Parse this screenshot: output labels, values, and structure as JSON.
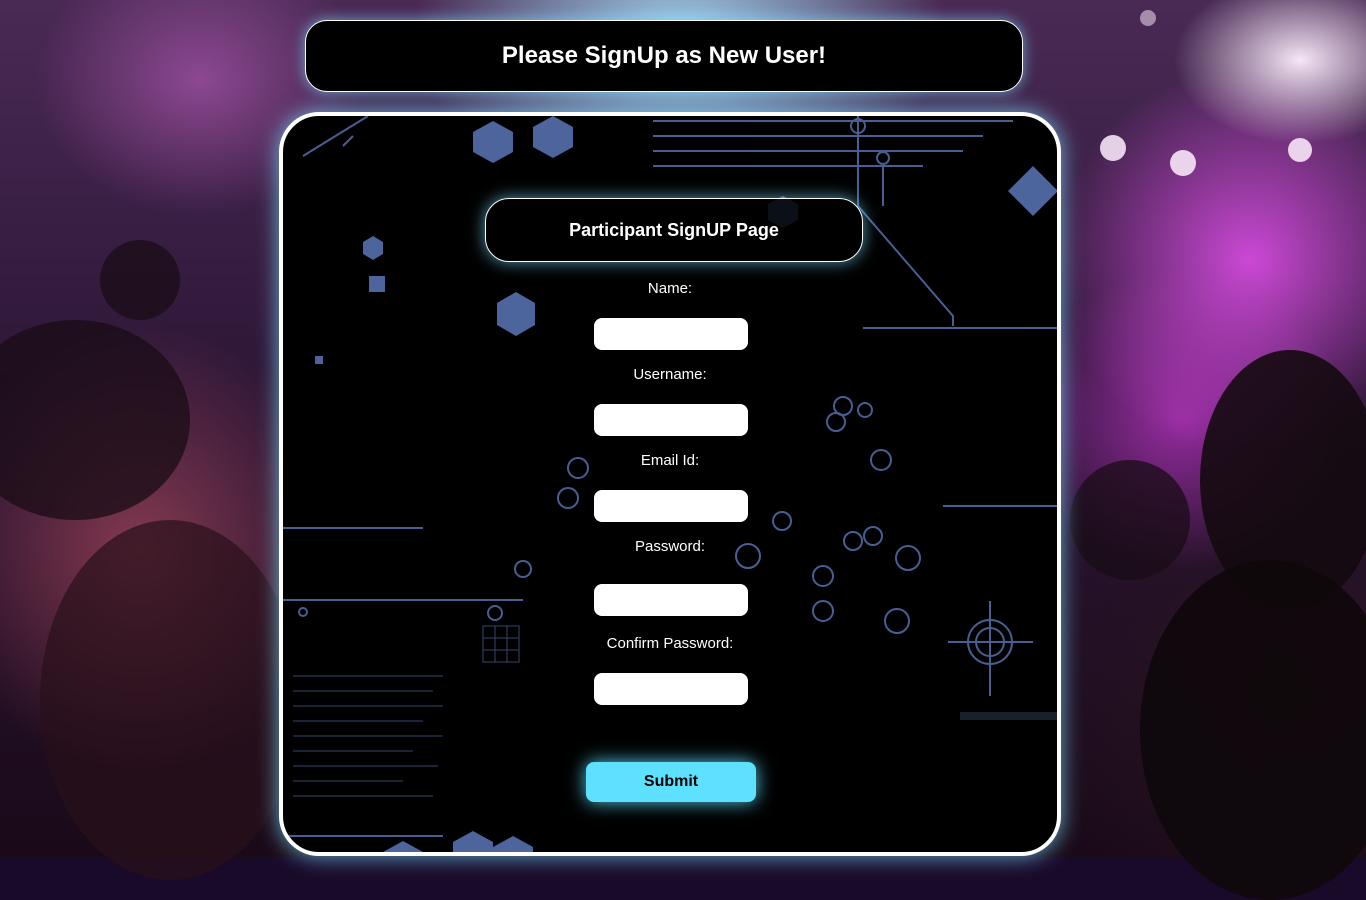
{
  "header": {
    "title": "Please SignUp as New User!"
  },
  "form": {
    "title": "Participant SignUP Page",
    "fields": [
      {
        "label": "Name:",
        "value": ""
      },
      {
        "label": "Username:",
        "value": ""
      },
      {
        "label": "Email Id:",
        "value": ""
      },
      {
        "label": "Password:",
        "value": ""
      },
      {
        "label": "Confirm Password:",
        "value": ""
      }
    ],
    "submit_label": "Submit"
  },
  "colors": {
    "accent": "#5ee0ff",
    "panel_bg": "#000000",
    "glow": "#78dcff"
  }
}
